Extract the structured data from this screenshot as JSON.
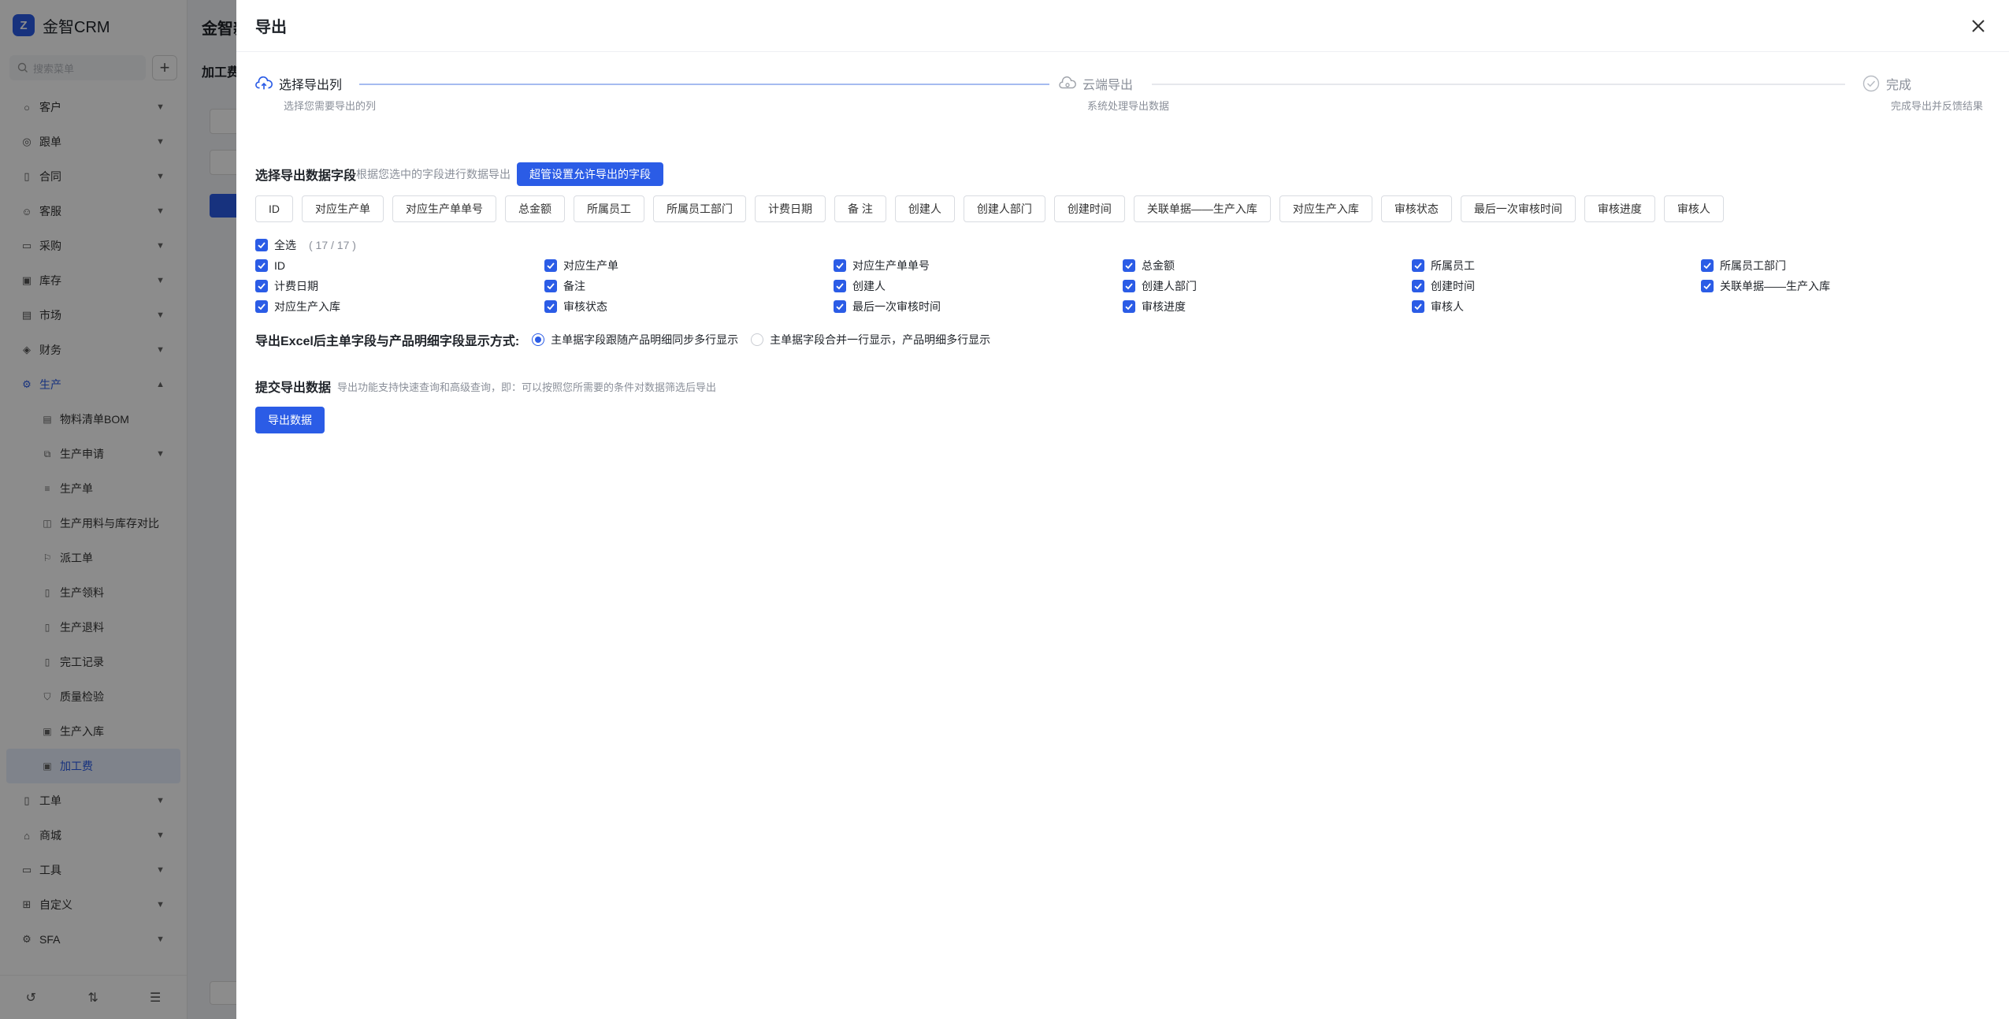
{
  "app": {
    "brand": "金智CRM",
    "search_placeholder": "搜索菜单",
    "page_title": "金智新",
    "page_subtitle": "加工费",
    "menu": [
      {
        "label": "客户",
        "icon": "user-icon"
      },
      {
        "label": "跟单",
        "icon": "target-icon"
      },
      {
        "label": "合同",
        "icon": "contract-icon"
      },
      {
        "label": "客服",
        "icon": "service-icon"
      },
      {
        "label": "采购",
        "icon": "cart-icon"
      },
      {
        "label": "库存",
        "icon": "warehouse-icon"
      },
      {
        "label": "市场",
        "icon": "market-icon"
      },
      {
        "label": "财务",
        "icon": "finance-icon"
      },
      {
        "label": "生产",
        "icon": "production-icon"
      }
    ],
    "submenu": [
      {
        "label": "物料清单BOM"
      },
      {
        "label": "生产申请"
      },
      {
        "label": "生产单"
      },
      {
        "label": "生产用料与库存对比"
      },
      {
        "label": "派工单"
      },
      {
        "label": "生产领料"
      },
      {
        "label": "生产退料"
      },
      {
        "label": "完工记录"
      },
      {
        "label": "质量检验"
      },
      {
        "label": "生产入库"
      },
      {
        "label": "加工费"
      }
    ],
    "menu_bottom": [
      {
        "label": "工单"
      },
      {
        "label": "商城"
      },
      {
        "label": "工具"
      },
      {
        "label": "自定义"
      },
      {
        "label": "SFA"
      }
    ]
  },
  "drawer": {
    "title": "导出",
    "steps": [
      {
        "title": "选择导出列",
        "desc": "选择您需要导出的列"
      },
      {
        "title": "云端导出",
        "desc": "系统处理导出数据"
      },
      {
        "title": "完成",
        "desc": "完成导出并反馈结果"
      }
    ],
    "select_section": {
      "title": "选择导出数据字段",
      "hint": "根据您选中的字段进行数据导出",
      "button": "超管设置允许导出的字段"
    },
    "tags": [
      "ID",
      "对应生产单",
      "对应生产单单号",
      "总金额",
      "所属员工",
      "所属员工部门",
      "计费日期",
      "备 注",
      "创建人",
      "创建人部门",
      "创建时间",
      "关联单据——生产入库",
      "对应生产入库",
      "审核状态",
      "最后一次审核时间",
      "审核进度",
      "审核人"
    ],
    "select_all": {
      "label": "全选",
      "count": "( 17 / 17 )"
    },
    "fields": [
      "ID",
      "对应生产单",
      "对应生产单单号",
      "总金额",
      "所属员工",
      "所属员工部门",
      "计费日期",
      "备注",
      "创建人",
      "创建人部门",
      "创建时间",
      "关联单据——生产入库",
      "对应生产入库",
      "审核状态",
      "最后一次审核时间",
      "审核进度",
      "审核人"
    ],
    "display_mode": {
      "title": "导出Excel后主单字段与产品明细字段显示方式:",
      "options": [
        "主单据字段跟随产品明细同步多行显示",
        "主单据字段合并一行显示，产品明细多行显示"
      ],
      "selected": 0
    },
    "submit_section": {
      "title": "提交导出数据",
      "hint": "导出功能支持快速查询和高级查询，即：可以按照您所需要的条件对数据筛选后导出",
      "button": "导出数据"
    }
  }
}
